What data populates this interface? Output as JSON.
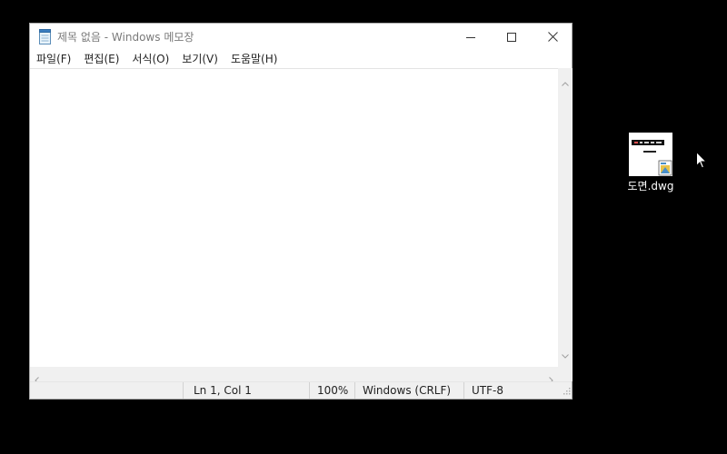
{
  "window": {
    "title": "제목 없음 - Windows 메모장",
    "app_icon": "notepad-icon",
    "controls": {
      "minimize": "minimize-icon",
      "maximize": "maximize-icon",
      "close": "close-icon"
    }
  },
  "menu": {
    "items": [
      "파일(F)",
      "편집(E)",
      "서식(O)",
      "보기(V)",
      "도움말(H)"
    ]
  },
  "editor": {
    "content": ""
  },
  "statusbar": {
    "position": "Ln 1, Col 1",
    "zoom": "100%",
    "line_ending": "Windows (CRLF)",
    "encoding": "UTF-8"
  },
  "desktop": {
    "icons": [
      {
        "label": "도면.dwg",
        "icon": "dwg-file-icon"
      }
    ]
  },
  "colors": {
    "desktop_bg": "#000000",
    "window_bg": "#ffffff",
    "chrome_bg": "#f0f0f0"
  }
}
